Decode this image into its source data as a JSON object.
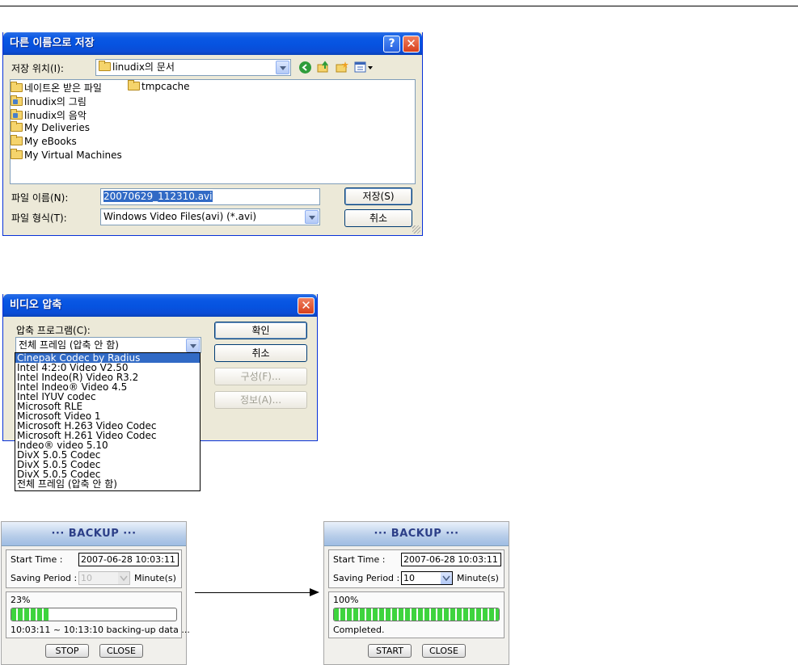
{
  "save_dialog": {
    "title": "다른 이름으로 저장",
    "location_label": "저장 위치(I):",
    "location_value": "linudix의 문서",
    "files": [
      "네이트온 받은 파일",
      "linudix의 그림",
      "linudix의 음악",
      "My Deliveries",
      "My eBooks",
      "My Virtual Machines",
      "tmpcache"
    ],
    "filename_label": "파일 이름(N):",
    "filename_value": "20070629_112310.avi",
    "filetype_label": "파일 형식(T):",
    "filetype_value": "Windows Video Files(avi) (*.avi)",
    "save_button": "저장(S)",
    "cancel_button": "취소",
    "help_glyph": "?",
    "close_glyph": "✕"
  },
  "compress_dialog": {
    "title": "비디오 압축",
    "program_label": "압축 프로그램(C):",
    "selected_value": "전체 프레임 (압축 안 함)",
    "ok_button": "확인",
    "cancel_button": "취소",
    "configure_button": "구성(F)...",
    "about_button": "정보(A)...",
    "close_glyph": "✕",
    "options": [
      "Cinepak Codec by Radius",
      "Intel 4:2:0 Video V2.50",
      "Intel Indeo(R) Video R3.2",
      "Intel Indeo® Video 4.5",
      "Intel IYUV codec",
      "Microsoft RLE",
      "Microsoft Video 1",
      "Microsoft H.263 Video Codec",
      "Microsoft H.261 Video Codec",
      "Indeo® video 5.10",
      "DivX 5.0.5 Codec",
      "DivX 5.0.5 Codec",
      "DivX 5.0.5 Codec",
      "전체 프레임 (압축 안 함)"
    ]
  },
  "backup_left": {
    "title": "··· BACKUP ···",
    "start_label": "Start Time :",
    "start_value": "2007-06-28 10:03:11",
    "period_label": "Saving Period :",
    "period_value": "10",
    "period_unit": "Minute(s)",
    "percent": "23%",
    "progress": 0.23,
    "status": "10:03:11 ~ 10:13:10 backing-up data ...",
    "btn1": "STOP",
    "btn2": "CLOSE"
  },
  "backup_right": {
    "title": "··· BACKUP ···",
    "start_label": "Start Time :",
    "start_value": "2007-06-28 10:03:11",
    "period_label": "Saving Period :",
    "period_value": "10",
    "period_unit": "Minute(s)",
    "percent": "100%",
    "progress": 1.0,
    "status": "Completed.",
    "btn1": "START",
    "btn2": "CLOSE"
  }
}
